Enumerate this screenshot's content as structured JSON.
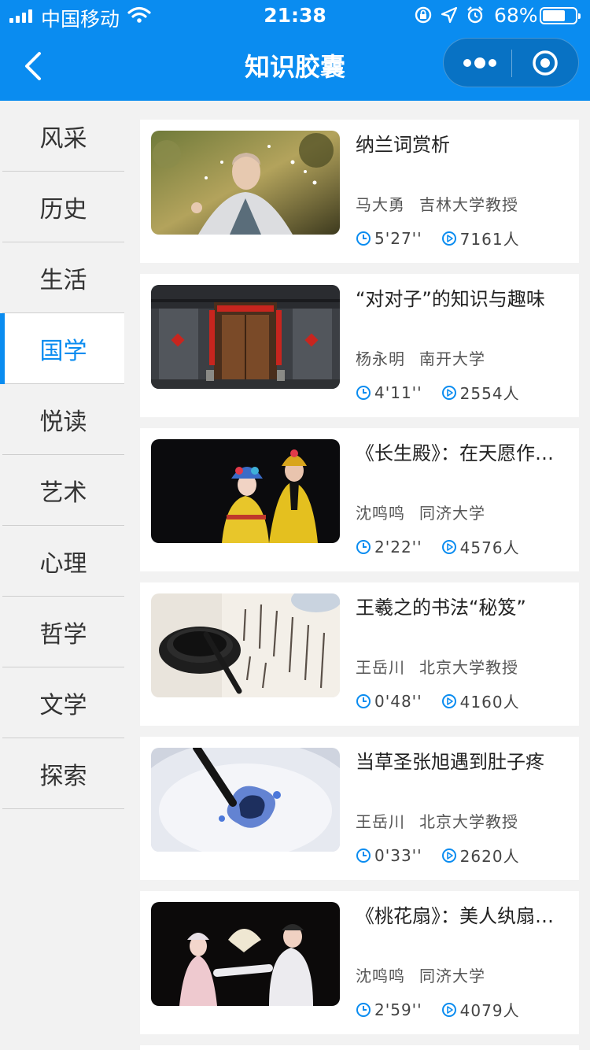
{
  "status_bar": {
    "carrier": "中国移动",
    "time": "21:38",
    "battery_percent": "68%",
    "battery_level": 0.68
  },
  "nav": {
    "title": "知识胶囊"
  },
  "colors": {
    "accent": "#0a8cf0",
    "background": "#f2f2f2",
    "card": "#ffffff"
  },
  "sidebar": {
    "active_index": 3,
    "items": [
      {
        "label": "风采"
      },
      {
        "label": "历史"
      },
      {
        "label": "生活"
      },
      {
        "label": "国学"
      },
      {
        "label": "悦读"
      },
      {
        "label": "艺术"
      },
      {
        "label": "心理"
      },
      {
        "label": "哲学"
      },
      {
        "label": "文学"
      },
      {
        "label": "探索"
      }
    ]
  },
  "list": {
    "items": [
      {
        "title": "纳兰词赏析",
        "author": "马大勇",
        "affiliation": "吉林大学教授",
        "duration": "5'27''",
        "views": "7161人",
        "thumb": "man-in-qing-robe"
      },
      {
        "title": "“对对子”的知识与趣味",
        "author": "杨永明",
        "affiliation": "南开大学",
        "duration": "4'11''",
        "views": "2554人",
        "thumb": "red-couplet-gate"
      },
      {
        "title": "《长生殿》：在天愿作…",
        "author": "沈鸣鸣",
        "affiliation": "同济大学",
        "duration": "2'22''",
        "views": "4576人",
        "thumb": "opera-performers"
      },
      {
        "title": "王羲之的书法“秘笈”",
        "author": "王岳川",
        "affiliation": "北京大学教授",
        "duration": "0'48''",
        "views": "4160人",
        "thumb": "inkstone-calligraphy"
      },
      {
        "title": "当草圣张旭遇到肚子疼",
        "author": "王岳川",
        "affiliation": "北京大学教授",
        "duration": "0'33''",
        "views": "2620人",
        "thumb": "ink-brush-bowl"
      },
      {
        "title": "《桃花扇》：美人纨扇…",
        "author": "沈鸣鸣",
        "affiliation": "同济大学",
        "duration": "2'59''",
        "views": "4079人",
        "thumb": "opera-fan-duet"
      }
    ]
  }
}
